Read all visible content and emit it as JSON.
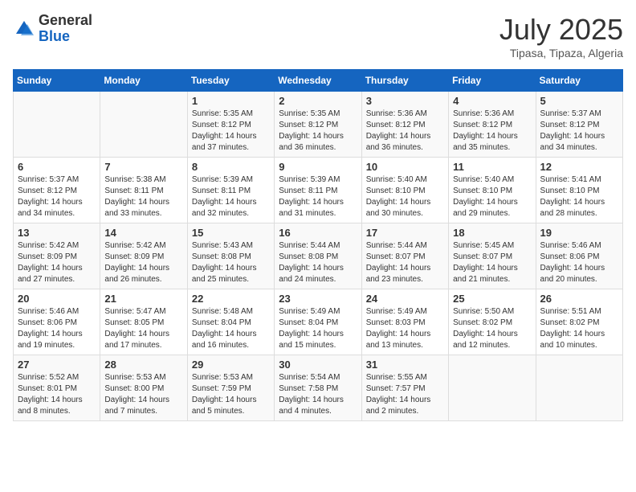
{
  "header": {
    "logo": {
      "line1": "General",
      "line2": "Blue"
    },
    "month": "July 2025",
    "location": "Tipasa, Tipaza, Algeria"
  },
  "weekdays": [
    "Sunday",
    "Monday",
    "Tuesday",
    "Wednesday",
    "Thursday",
    "Friday",
    "Saturday"
  ],
  "weeks": [
    [
      {
        "day": "",
        "info": ""
      },
      {
        "day": "",
        "info": ""
      },
      {
        "day": "1",
        "info": "Sunrise: 5:35 AM\nSunset: 8:12 PM\nDaylight: 14 hours and 37 minutes."
      },
      {
        "day": "2",
        "info": "Sunrise: 5:35 AM\nSunset: 8:12 PM\nDaylight: 14 hours and 36 minutes."
      },
      {
        "day": "3",
        "info": "Sunrise: 5:36 AM\nSunset: 8:12 PM\nDaylight: 14 hours and 36 minutes."
      },
      {
        "day": "4",
        "info": "Sunrise: 5:36 AM\nSunset: 8:12 PM\nDaylight: 14 hours and 35 minutes."
      },
      {
        "day": "5",
        "info": "Sunrise: 5:37 AM\nSunset: 8:12 PM\nDaylight: 14 hours and 34 minutes."
      }
    ],
    [
      {
        "day": "6",
        "info": "Sunrise: 5:37 AM\nSunset: 8:12 PM\nDaylight: 14 hours and 34 minutes."
      },
      {
        "day": "7",
        "info": "Sunrise: 5:38 AM\nSunset: 8:11 PM\nDaylight: 14 hours and 33 minutes."
      },
      {
        "day": "8",
        "info": "Sunrise: 5:39 AM\nSunset: 8:11 PM\nDaylight: 14 hours and 32 minutes."
      },
      {
        "day": "9",
        "info": "Sunrise: 5:39 AM\nSunset: 8:11 PM\nDaylight: 14 hours and 31 minutes."
      },
      {
        "day": "10",
        "info": "Sunrise: 5:40 AM\nSunset: 8:10 PM\nDaylight: 14 hours and 30 minutes."
      },
      {
        "day": "11",
        "info": "Sunrise: 5:40 AM\nSunset: 8:10 PM\nDaylight: 14 hours and 29 minutes."
      },
      {
        "day": "12",
        "info": "Sunrise: 5:41 AM\nSunset: 8:10 PM\nDaylight: 14 hours and 28 minutes."
      }
    ],
    [
      {
        "day": "13",
        "info": "Sunrise: 5:42 AM\nSunset: 8:09 PM\nDaylight: 14 hours and 27 minutes."
      },
      {
        "day": "14",
        "info": "Sunrise: 5:42 AM\nSunset: 8:09 PM\nDaylight: 14 hours and 26 minutes."
      },
      {
        "day": "15",
        "info": "Sunrise: 5:43 AM\nSunset: 8:08 PM\nDaylight: 14 hours and 25 minutes."
      },
      {
        "day": "16",
        "info": "Sunrise: 5:44 AM\nSunset: 8:08 PM\nDaylight: 14 hours and 24 minutes."
      },
      {
        "day": "17",
        "info": "Sunrise: 5:44 AM\nSunset: 8:07 PM\nDaylight: 14 hours and 23 minutes."
      },
      {
        "day": "18",
        "info": "Sunrise: 5:45 AM\nSunset: 8:07 PM\nDaylight: 14 hours and 21 minutes."
      },
      {
        "day": "19",
        "info": "Sunrise: 5:46 AM\nSunset: 8:06 PM\nDaylight: 14 hours and 20 minutes."
      }
    ],
    [
      {
        "day": "20",
        "info": "Sunrise: 5:46 AM\nSunset: 8:06 PM\nDaylight: 14 hours and 19 minutes."
      },
      {
        "day": "21",
        "info": "Sunrise: 5:47 AM\nSunset: 8:05 PM\nDaylight: 14 hours and 17 minutes."
      },
      {
        "day": "22",
        "info": "Sunrise: 5:48 AM\nSunset: 8:04 PM\nDaylight: 14 hours and 16 minutes."
      },
      {
        "day": "23",
        "info": "Sunrise: 5:49 AM\nSunset: 8:04 PM\nDaylight: 14 hours and 15 minutes."
      },
      {
        "day": "24",
        "info": "Sunrise: 5:49 AM\nSunset: 8:03 PM\nDaylight: 14 hours and 13 minutes."
      },
      {
        "day": "25",
        "info": "Sunrise: 5:50 AM\nSunset: 8:02 PM\nDaylight: 14 hours and 12 minutes."
      },
      {
        "day": "26",
        "info": "Sunrise: 5:51 AM\nSunset: 8:02 PM\nDaylight: 14 hours and 10 minutes."
      }
    ],
    [
      {
        "day": "27",
        "info": "Sunrise: 5:52 AM\nSunset: 8:01 PM\nDaylight: 14 hours and 8 minutes."
      },
      {
        "day": "28",
        "info": "Sunrise: 5:53 AM\nSunset: 8:00 PM\nDaylight: 14 hours and 7 minutes."
      },
      {
        "day": "29",
        "info": "Sunrise: 5:53 AM\nSunset: 7:59 PM\nDaylight: 14 hours and 5 minutes."
      },
      {
        "day": "30",
        "info": "Sunrise: 5:54 AM\nSunset: 7:58 PM\nDaylight: 14 hours and 4 minutes."
      },
      {
        "day": "31",
        "info": "Sunrise: 5:55 AM\nSunset: 7:57 PM\nDaylight: 14 hours and 2 minutes."
      },
      {
        "day": "",
        "info": ""
      },
      {
        "day": "",
        "info": ""
      }
    ]
  ]
}
